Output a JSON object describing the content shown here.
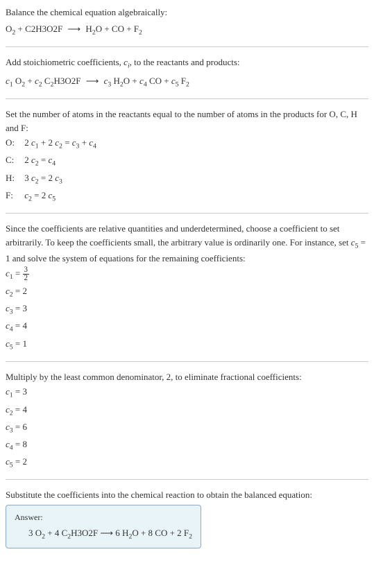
{
  "intro": {
    "text": "Balance the chemical equation algebraically:",
    "equation_lhs": "O₂ + C2H3O2F",
    "equation_arrow": "⟶",
    "equation_rhs": "H₂O + CO + F₂"
  },
  "step1": {
    "text_prefix": "Add stoichiometric coefficients, ",
    "ci": "cᵢ",
    "text_suffix": ", to the reactants and products:",
    "eq_c1": "c₁",
    "eq_c2": "c₂",
    "eq_c3": "c₃",
    "eq_c4": "c₄",
    "eq_c5": "c₅",
    "sp_O2": "O₂",
    "sp_C2H3O2F": "C₂H3O2F",
    "sp_H2O": "H₂O",
    "sp_CO": "CO",
    "sp_F2": "F₂",
    "arrow": "⟶"
  },
  "step2": {
    "text": "Set the number of atoms in the reactants equal to the number of atoms in the products for O, C, H and F:",
    "rows": [
      {
        "label": "O:",
        "eq": "2 c₁ + 2 c₂ = c₃ + c₄"
      },
      {
        "label": "C:",
        "eq": "2 c₂ = c₄"
      },
      {
        "label": "H:",
        "eq": "3 c₂ = 2 c₃"
      },
      {
        "label": "F:",
        "eq": "c₂ = 2 c₅"
      }
    ]
  },
  "step3": {
    "text": "Since the coefficients are relative quantities and underdetermined, choose a coefficient to set arbitrarily. To keep the coefficients small, the arbitrary value is ordinarily one. For instance, set c₅ = 1 and solve the system of equations for the remaining coefficients:",
    "c1_label": "c₁ = ",
    "c1_num": "3",
    "c1_den": "2",
    "coefs": [
      {
        "line": "c₂ = 2"
      },
      {
        "line": "c₃ = 3"
      },
      {
        "line": "c₄ = 4"
      },
      {
        "line": "c₅ = 1"
      }
    ]
  },
  "step4": {
    "text": "Multiply by the least common denominator, 2, to eliminate fractional coefficients:",
    "coefs": [
      {
        "line": "c₁ = 3"
      },
      {
        "line": "c₂ = 4"
      },
      {
        "line": "c₃ = 6"
      },
      {
        "line": "c₄ = 8"
      },
      {
        "line": "c₅ = 2"
      }
    ]
  },
  "step5": {
    "text": "Substitute the coefficients into the chemical reaction to obtain the balanced equation:"
  },
  "answer": {
    "label": "Answer:",
    "equation": "3 O₂ + 4 C₂H3O2F ⟶ 6 H₂O + 8 CO + 2 F₂"
  },
  "chart_data": {
    "type": "table",
    "title": "Chemical equation balancing",
    "unbalanced": "O2 + C2H3O2F -> H2O + CO + F2",
    "balanced": "3 O2 + 4 C2H3O2F -> 6 H2O + 8 CO + 2 F2",
    "atom_balance_equations": {
      "O": "2c1 + 2c2 = c3 + c4",
      "C": "2c2 = c4",
      "H": "3c2 = 2c3",
      "F": "c2 = 2c5"
    },
    "initial_solution_c5_1": {
      "c1": 1.5,
      "c2": 2,
      "c3": 3,
      "c4": 4,
      "c5": 1
    },
    "final_coefficients": {
      "c1": 3,
      "c2": 4,
      "c3": 6,
      "c4": 8,
      "c5": 2
    }
  }
}
